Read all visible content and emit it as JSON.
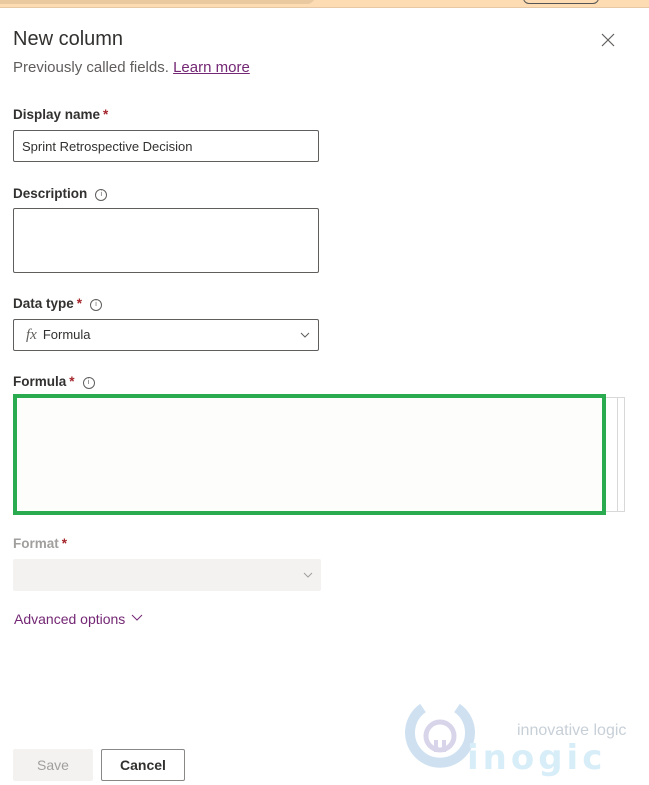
{
  "panel": {
    "title": "New column",
    "subtitle": "Previously called fields.",
    "learn_more": "Learn more"
  },
  "fields": {
    "display_name": {
      "label": "Display name",
      "required": "*",
      "value": "Sprint Retrospective Decision"
    },
    "description": {
      "label": "Description",
      "value": ""
    },
    "data_type": {
      "label": "Data type",
      "required": "*",
      "icon": "fx",
      "value": "Formula"
    },
    "formula": {
      "label": "Formula",
      "required": "*",
      "value": ""
    },
    "format": {
      "label": "Format",
      "required": "*",
      "value": ""
    }
  },
  "advanced_options": "Advanced options",
  "footer": {
    "save": "Save",
    "cancel": "Cancel"
  },
  "watermark": {
    "tagline": "innovative logic",
    "brand": "inogic"
  },
  "info_glyph": "i",
  "colors": {
    "accent": "#742774",
    "highlight": "#2aab4f",
    "required": "#a4262c"
  }
}
